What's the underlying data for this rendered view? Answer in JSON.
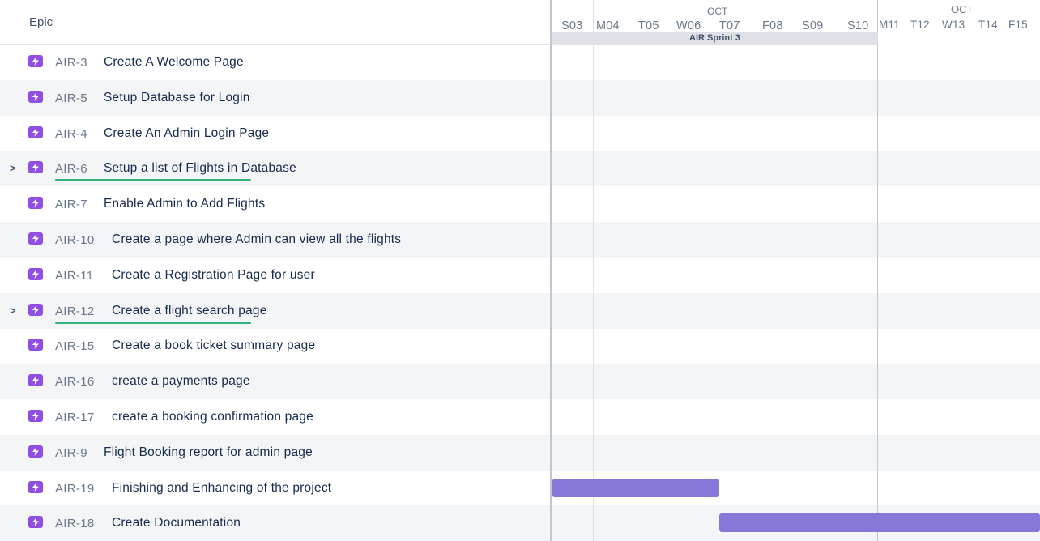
{
  "header": {
    "epic_label": "Epic"
  },
  "timeline": {
    "month1": "OCT",
    "month2": "OCT",
    "days": [
      "S03",
      "M04",
      "T05",
      "W06",
      "T07",
      "F08",
      "S09",
      "S10",
      "M11",
      "T12",
      "W13",
      "T14",
      "F15"
    ],
    "sprint_label": "AIR Sprint 3"
  },
  "epics": [
    {
      "key": "AIR-3",
      "summary": "Create A Welcome Page",
      "expandable": false,
      "chevron": "",
      "has_progress": false
    },
    {
      "key": "AIR-5",
      "summary": "Setup Database for Login",
      "expandable": false,
      "chevron": "",
      "has_progress": false
    },
    {
      "key": "AIR-4",
      "summary": "Create An Admin Login Page",
      "expandable": false,
      "chevron": "",
      "has_progress": false
    },
    {
      "key": "AIR-6",
      "summary": "Setup a list of Flights in Database",
      "expandable": true,
      "chevron": ">",
      "has_progress": true
    },
    {
      "key": "AIR-7",
      "summary": "Enable Admin to Add Flights",
      "expandable": false,
      "chevron": "",
      "has_progress": false
    },
    {
      "key": "AIR-10",
      "summary": "Create a page where Admin can view all the flights",
      "expandable": false,
      "chevron": "",
      "has_progress": false
    },
    {
      "key": "AIR-11",
      "summary": "Create a Registration Page for user",
      "expandable": false,
      "chevron": "",
      "has_progress": false
    },
    {
      "key": "AIR-12",
      "summary": "Create a flight search page",
      "expandable": true,
      "chevron": ">",
      "has_progress": true
    },
    {
      "key": "AIR-15",
      "summary": "Create a book ticket summary page",
      "expandable": false,
      "chevron": "",
      "has_progress": false
    },
    {
      "key": "AIR-16",
      "summary": "create a payments page",
      "expandable": false,
      "chevron": "",
      "has_progress": false
    },
    {
      "key": "AIR-17",
      "summary": "create a booking confirmation page",
      "expandable": false,
      "chevron": "",
      "has_progress": false
    },
    {
      "key": "AIR-9",
      "summary": "Flight Booking report for admin page",
      "expandable": false,
      "chevron": "",
      "has_progress": false
    },
    {
      "key": "AIR-19",
      "summary": "Finishing and Enhancing of the project",
      "expandable": false,
      "chevron": "",
      "has_progress": false
    },
    {
      "key": "AIR-18",
      "summary": "Create Documentation",
      "expandable": false,
      "chevron": "",
      "has_progress": false
    }
  ],
  "colors": {
    "epic_icon": "#904ee2",
    "bar": "#8777d9",
    "progress": "#36b37e",
    "row_alt": "#f4f5f7"
  }
}
